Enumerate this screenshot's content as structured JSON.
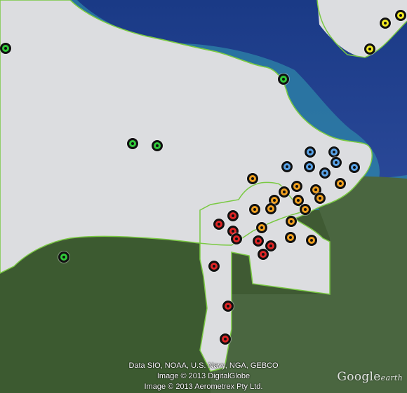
{
  "colors": {
    "ocean": "#1f3f84",
    "ocean_shallow": "#2c7fa3",
    "region_fill": "#dcdde0",
    "terrain": "#3f5a33",
    "boundary": "#7ac943",
    "green": "#31c93a",
    "yellow": "#f2ea22",
    "blue": "#5aa3e8",
    "orange": "#f0a020",
    "red": "#e02525"
  },
  "markers": {
    "green": 5,
    "yellow": 3,
    "blue": 8,
    "orange": 17,
    "red": 13
  },
  "attribution": {
    "line1": "Data SIO, NOAA, U.S. Navy, NGA, GEBCO",
    "line2": "Image © 2013 DigitalGlobe",
    "line3": "Image © 2013 Aerometrex Pty Ltd."
  },
  "logo": {
    "brand": "Google",
    "product": "earth"
  }
}
